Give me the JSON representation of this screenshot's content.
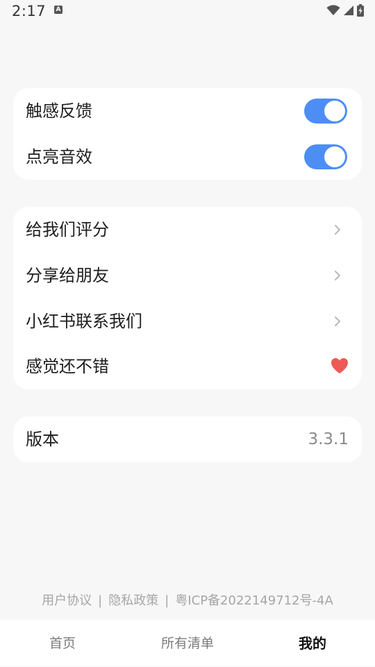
{
  "status_bar": {
    "time": "2:17",
    "notification_icon": "A",
    "icons": [
      "wifi-icon",
      "signal-icon",
      "battery-charging-icon"
    ]
  },
  "toggles_card": {
    "items": [
      {
        "label": "触感反馈",
        "state": "on"
      },
      {
        "label": "点亮音效",
        "state": "on"
      }
    ]
  },
  "links_card": {
    "items": [
      {
        "label": "给我们评分",
        "icon": "chevron-right-icon"
      },
      {
        "label": "分享给朋友",
        "icon": "chevron-right-icon"
      },
      {
        "label": "小红书联系我们",
        "icon": "chevron-right-icon"
      },
      {
        "label": "感觉还不错",
        "icon": "heart-icon"
      }
    ]
  },
  "version_card": {
    "label": "版本",
    "value": "3.3.1"
  },
  "footer": {
    "user_agreement": "用户协议",
    "separator": "|",
    "privacy_policy": "隐私政策",
    "icp": "粤ICP备2022149712号-4A"
  },
  "tab_bar": {
    "tabs": [
      {
        "label": "首页",
        "active": false
      },
      {
        "label": "所有清单",
        "active": false
      },
      {
        "label": "我的",
        "active": true
      }
    ]
  },
  "colors": {
    "accent": "#4d8ef5",
    "heart": "#ee5a55",
    "background": "#f7f7f7",
    "card": "#ffffff"
  }
}
